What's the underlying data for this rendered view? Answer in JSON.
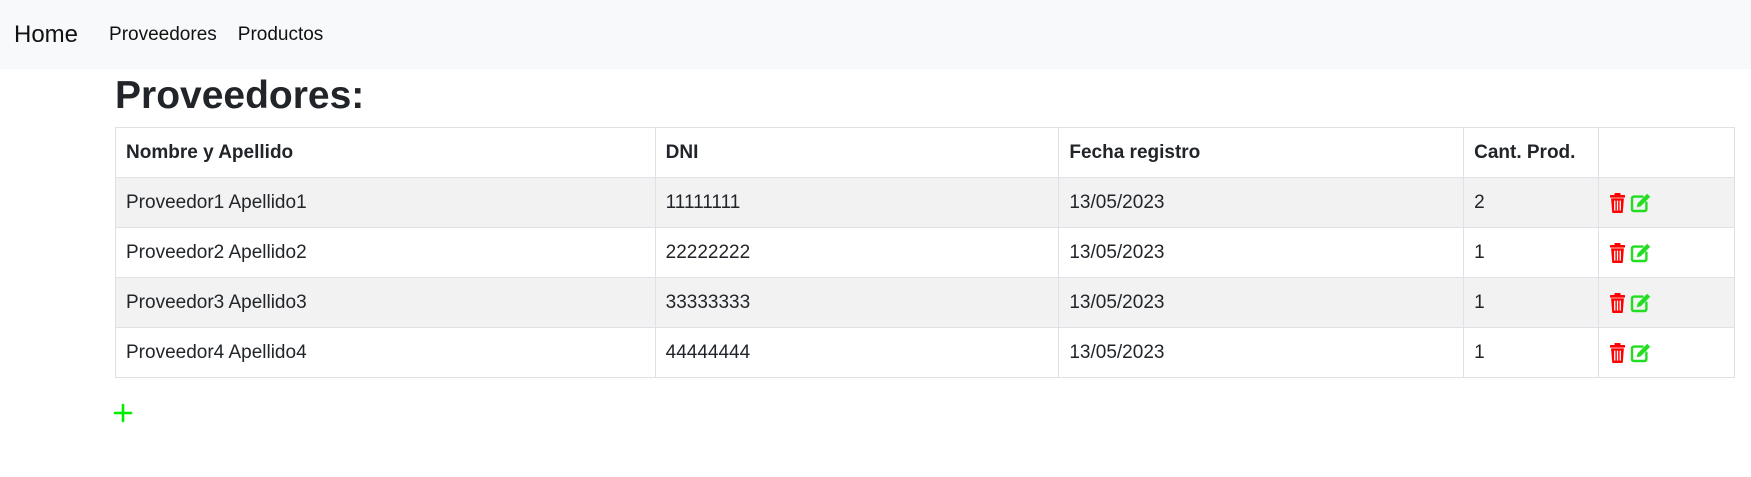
{
  "nav": {
    "brand": "Home",
    "links": [
      "Proveedores",
      "Productos"
    ]
  },
  "page": {
    "title": "Proveedores:"
  },
  "table": {
    "headers": [
      "Nombre y Apellido",
      "DNI",
      "Fecha registro",
      "Cant. Prod.",
      ""
    ],
    "rows": [
      {
        "name": "Proveedor1 Apellido1",
        "dni": "11111111",
        "date": "13/05/2023",
        "count": "2"
      },
      {
        "name": "Proveedor2 Apellido2",
        "dni": "22222222",
        "date": "13/05/2023",
        "count": "1"
      },
      {
        "name": "Proveedor3 Apellido3",
        "dni": "33333333",
        "date": "13/05/2023",
        "count": "1"
      },
      {
        "name": "Proveedor4 Apellido4",
        "dni": "44444444",
        "date": "13/05/2023",
        "count": "1"
      }
    ]
  },
  "icons": {
    "delete": "trash-icon",
    "edit": "edit-icon",
    "add": "plus-icon"
  },
  "colors": {
    "delete": "#ff0000",
    "edit": "#22dd22",
    "add": "#00ee00",
    "stripe": "#f2f2f2",
    "navbar": "#f8f9fa"
  }
}
